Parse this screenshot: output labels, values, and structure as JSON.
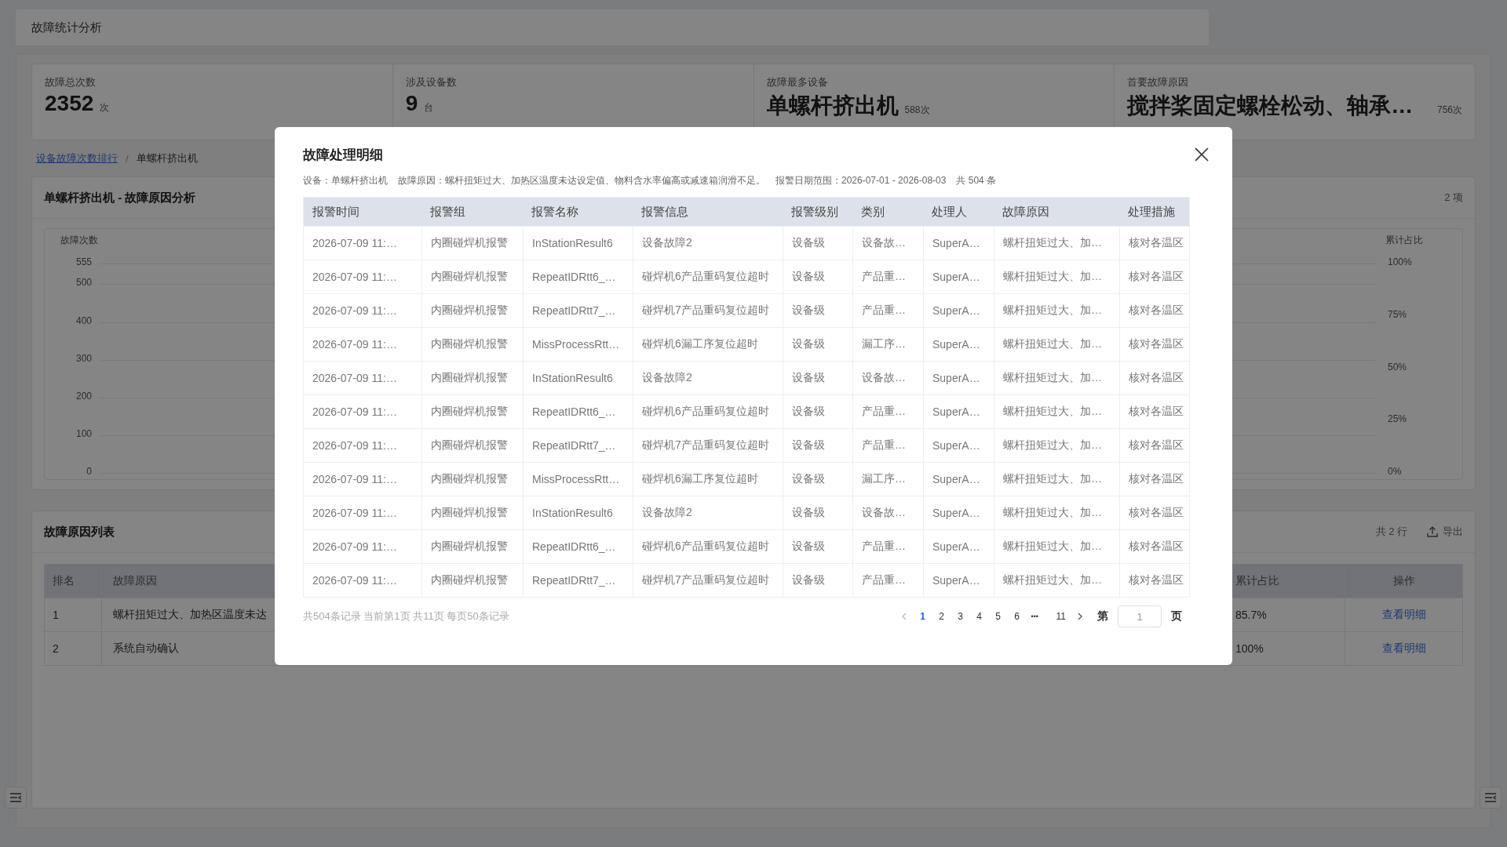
{
  "page": {
    "title": "故障统计分析"
  },
  "stats": [
    {
      "label": "故障总次数",
      "value": "2352",
      "unit": "次"
    },
    {
      "label": "涉及设备数",
      "value": "9",
      "unit": "台"
    },
    {
      "label": "故障最多设备",
      "value": "单螺杆挤出机",
      "unit": "588次"
    },
    {
      "label": "首要故障原因",
      "value": "搅拌桨固定螺栓松动、轴承…",
      "unit": "756次"
    }
  ],
  "breadcrumb": {
    "separator": "/",
    "items": [
      {
        "label": "设备故障次数排行",
        "kind": "link"
      },
      {
        "label": "单螺杆挤出机",
        "kind": "current"
      }
    ]
  },
  "chart_card": {
    "title": "单螺杆挤出机 - 故障原因分析",
    "count": "2 项",
    "y_title": "故障次数",
    "y_ticks": [
      "555",
      "500",
      "400",
      "300",
      "200",
      "100",
      "0"
    ],
    "y2_title": "累计占比",
    "y2_ticks": [
      "100%",
      "75%",
      "50%",
      "25%",
      "0%"
    ]
  },
  "reason_list": {
    "title": "故障原因列表",
    "row_count": "共 2 行",
    "export": "导出",
    "columns": [
      "排名",
      "故障原因",
      "累计占比",
      "操作"
    ],
    "rows": [
      {
        "rank": "1",
        "reason": "螺杆扭矩过大、加热区温度未达",
        "cumulative": "85.7%",
        "action": "查看明细"
      },
      {
        "rank": "2",
        "reason": "系统自动确认",
        "cumulative": "100%",
        "action": "查看明细"
      }
    ]
  },
  "dialog": {
    "title": "故障处理明细",
    "info": [
      {
        "label": "设备：",
        "value": "单螺杆挤出机"
      },
      {
        "label": "故障原因：",
        "value": "螺杆扭矩过大、加热区温度未达设定值、物料含水率偏高或减速箱润滑不足。"
      },
      {
        "label": "报警日期范围：",
        "value": "2026-07-01 - 2026-08-03"
      }
    ],
    "total": "共 504 条",
    "columns": [
      "报警时间",
      "报警组",
      "报警名称",
      "报警信息",
      "报警级别",
      "类别",
      "处理人",
      "故障原因",
      "处理措施"
    ],
    "rows": [
      [
        "2026-07-09 11:…",
        "内圈碰焊机报警",
        "InStationResult6",
        "设备故障2",
        "设备级",
        "设备故…",
        "SuperA…",
        "螺杆扭矩过大、加…",
        "核对各温区"
      ],
      [
        "2026-07-09 11:…",
        "内圈碰焊机报警",
        "RepeatIDRtt6_…",
        "碰焊机6产品重码复位超时",
        "设备级",
        "产品重…",
        "SuperA…",
        "螺杆扭矩过大、加…",
        "核对各温区"
      ],
      [
        "2026-07-09 11:…",
        "内圈碰焊机报警",
        "RepeatIDRtt7_…",
        "碰焊机7产品重码复位超时",
        "设备级",
        "产品重…",
        "SuperA…",
        "螺杆扭矩过大、加…",
        "核对各温区"
      ],
      [
        "2026-07-09 11:…",
        "内圈碰焊机报警",
        "MissProcessRtt…",
        "碰焊机6漏工序复位超时",
        "设备级",
        "漏工序…",
        "SuperA…",
        "螺杆扭矩过大、加…",
        "核对各温区"
      ],
      [
        "2026-07-09 11:…",
        "内圈碰焊机报警",
        "InStationResult6",
        "设备故障2",
        "设备级",
        "设备故…",
        "SuperA…",
        "螺杆扭矩过大、加…",
        "核对各温区"
      ],
      [
        "2026-07-09 11:…",
        "内圈碰焊机报警",
        "RepeatIDRtt6_…",
        "碰焊机6产品重码复位超时",
        "设备级",
        "产品重…",
        "SuperA…",
        "螺杆扭矩过大、加…",
        "核对各温区"
      ],
      [
        "2026-07-09 11:…",
        "内圈碰焊机报警",
        "RepeatIDRtt7_…",
        "碰焊机7产品重码复位超时",
        "设备级",
        "产品重…",
        "SuperA…",
        "螺杆扭矩过大、加…",
        "核对各温区"
      ],
      [
        "2026-07-09 11:…",
        "内圈碰焊机报警",
        "MissProcessRtt…",
        "碰焊机6漏工序复位超时",
        "设备级",
        "漏工序…",
        "SuperA…",
        "螺杆扭矩过大、加…",
        "核对各温区"
      ],
      [
        "2026-07-09 11:…",
        "内圈碰焊机报警",
        "InStationResult6",
        "设备故障2",
        "设备级",
        "设备故…",
        "SuperA…",
        "螺杆扭矩过大、加…",
        "核对各温区"
      ],
      [
        "2026-07-09 11:…",
        "内圈碰焊机报警",
        "RepeatIDRtt6_…",
        "碰焊机6产品重码复位超时",
        "设备级",
        "产品重…",
        "SuperA…",
        "螺杆扭矩过大、加…",
        "核对各温区"
      ],
      [
        "2026-07-09 11:…",
        "内圈碰焊机报警",
        "RepeatIDRtt7_…",
        "碰焊机7产品重码复位超时",
        "设备级",
        "产品重…",
        "SuperA…",
        "螺杆扭矩过大、加…",
        "核对各温区"
      ]
    ],
    "pagination": {
      "summary": "共504条记录 当前第1页 共11页 每页50条记录",
      "pages": [
        {
          "label": "1",
          "kind": "page",
          "selected": true
        },
        {
          "label": "2",
          "kind": "page",
          "selected": false
        },
        {
          "label": "3",
          "kind": "page",
          "selected": false
        },
        {
          "label": "4",
          "kind": "page",
          "selected": false
        },
        {
          "label": "5",
          "kind": "page",
          "selected": false
        },
        {
          "label": "6",
          "kind": "page",
          "selected": false
        },
        {
          "label": "•••",
          "kind": "ellipsis"
        },
        {
          "label": "11",
          "kind": "page",
          "selected": false
        }
      ],
      "goto_prefix": "第",
      "goto_value": "1",
      "goto_suffix": "页"
    }
  }
}
